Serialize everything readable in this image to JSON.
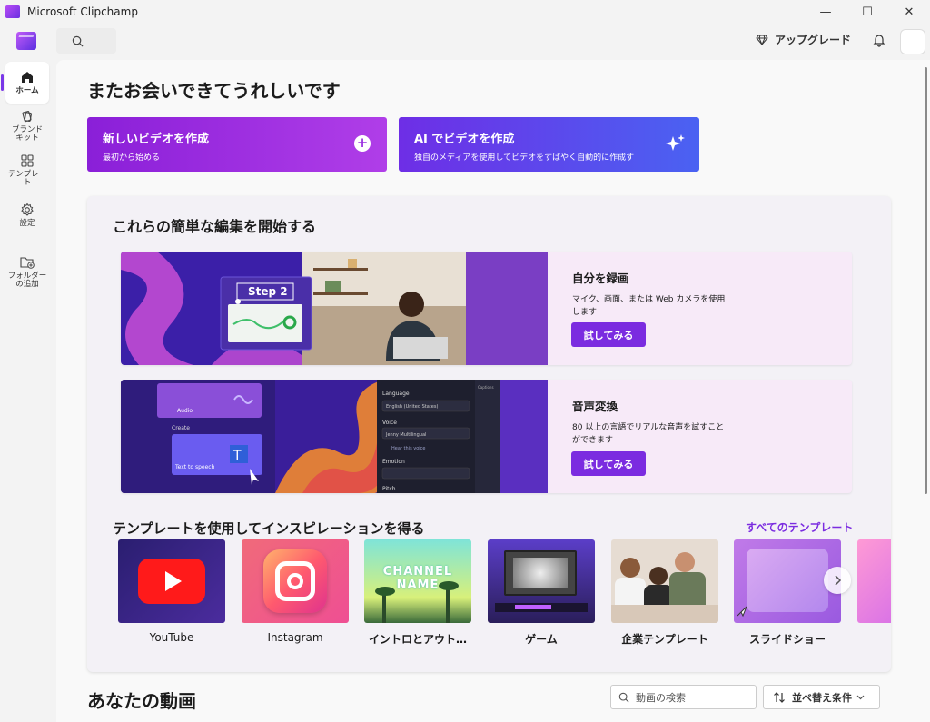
{
  "window": {
    "title": "Microsoft Clipchamp"
  },
  "header": {
    "upgrade_label": "アップグレード"
  },
  "sidebar": {
    "items": [
      {
        "label": "ホーム"
      },
      {
        "label": "ブランド\nキット"
      },
      {
        "label": "テンプレー\nト"
      },
      {
        "label": "設定"
      },
      {
        "label": "フォルダー\nの追加"
      }
    ]
  },
  "main": {
    "welcome": "またお会いできてうれしいです",
    "create_new": {
      "title": "新しいビデオを作成",
      "subtitle": "最初から始める"
    },
    "create_ai": {
      "title": "AI でビデオを作成",
      "subtitle": "独自のメディアを使用してビデオをすばやく自動的に作成す"
    },
    "quick_start": {
      "title": "これらの簡単な編集を開始する",
      "features": [
        {
          "title": "自分を録画",
          "desc": "マイク、画面、または Web カメラを使用します",
          "button": "試してみる",
          "image_caption": "Step 2"
        },
        {
          "title": "音声変換",
          "desc": "80 以上の言語でリアルな音声を試すことができます",
          "button": "試してみる",
          "image_texts": {
            "audio": "Audio",
            "create": "Create",
            "tts": "Text to speech",
            "language": "Language",
            "language_value": "English (United States)",
            "voice": "Voice",
            "voice_value": "Jenny Multilingual",
            "hear": "Hear this voice",
            "emotion": "Emotion",
            "pitch": "Pitch",
            "captions": "Captions"
          }
        }
      ]
    },
    "templates": {
      "title": "テンプレートを使用してインスピレーションを得る",
      "see_all": "すべてのテンプレート",
      "items": [
        {
          "label": "YouTube"
        },
        {
          "label": "Instagram"
        },
        {
          "label": "イントロとアウト…",
          "thumb_text": "CHANNEL NAME"
        },
        {
          "label": "ゲーム"
        },
        {
          "label": "企業テンプレート"
        },
        {
          "label": "スライドショー"
        }
      ]
    },
    "videos": {
      "title": "あなたの動画",
      "search_placeholder": "動画の検索",
      "sort_label": "並べ替え条件"
    }
  },
  "colors": {
    "accent": "#7b2ce0",
    "create_new": "#9a2ee0",
    "create_ai": "#5a4cee"
  }
}
